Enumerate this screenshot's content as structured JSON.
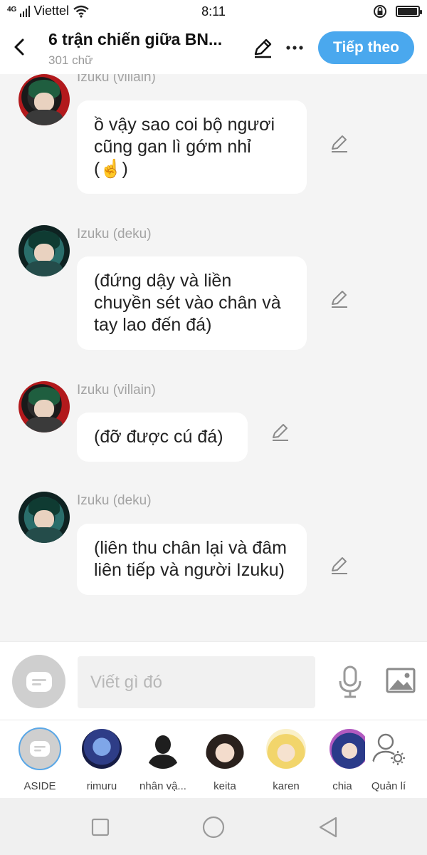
{
  "status_bar": {
    "network_type": "4G",
    "carrier": "Viettel",
    "time": "8:11"
  },
  "header": {
    "title": "6 trận chiến giữa BN...",
    "subtitle": "301 chữ",
    "next_label": "Tiếp theo"
  },
  "messages": [
    {
      "sender": "Izuku (villain)",
      "text": "ồ vậy sao coi bộ ngươi cũng gan lì gớm nhỉ (☝️)",
      "character": "villain"
    },
    {
      "sender": "Izuku (deku)",
      "text": "(đứng dậy và liền chuyền sét vào chân và tay lao đến đá)",
      "character": "deku"
    },
    {
      "sender": "Izuku (villain)",
      "text": "(đỡ được cú đá)",
      "character": "villain"
    },
    {
      "sender": "Izuku (deku)",
      "text": "(liên thu chân lại và đâm liên tiếp và người Izuku)",
      "character": "deku"
    }
  ],
  "input": {
    "placeholder": "Viết gì đó"
  },
  "characters": [
    {
      "label": "ASIDE",
      "icon": "aside-icon"
    },
    {
      "label": "rimuru",
      "icon": "rimuru-avatar"
    },
    {
      "label": "nhân vậ...",
      "icon": "silhouette-avatar"
    },
    {
      "label": "keita",
      "icon": "keita-avatar"
    },
    {
      "label": "karen",
      "icon": "karen-avatar"
    },
    {
      "label": "chia",
      "icon": "chia-avatar"
    },
    {
      "label": "Quản lí",
      "icon": "user-settings-icon"
    }
  ],
  "colors": {
    "accent": "#4aa8ee",
    "background": "#f4f4f4",
    "bubble": "#ffffff",
    "sender_text": "#a3a3a3"
  }
}
